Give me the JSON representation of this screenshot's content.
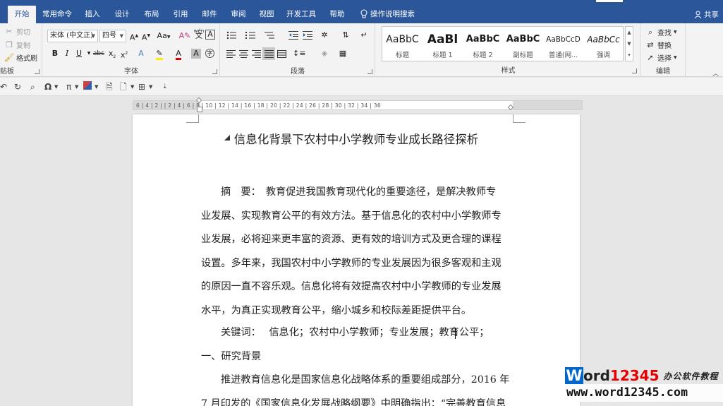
{
  "tabs": [
    {
      "label": "开始",
      "active": true
    },
    {
      "label": "常用命令"
    },
    {
      "label": "插入"
    },
    {
      "label": "设计"
    },
    {
      "label": "布局"
    },
    {
      "label": "引用"
    },
    {
      "label": "邮件"
    },
    {
      "label": "审阅"
    },
    {
      "label": "视图"
    },
    {
      "label": "开发工具"
    },
    {
      "label": "帮助"
    }
  ],
  "tell_me": "操作说明搜索",
  "share": "共享",
  "clipboard": {
    "cut": "剪切",
    "copy": "复制",
    "format_painter": "格式刷",
    "label": "贴板"
  },
  "font": {
    "name": "宋体 (中文正)",
    "size": "四号",
    "label": "字体",
    "aa": "Aa",
    "wen": "wén"
  },
  "paragraph": {
    "label": "段落"
  },
  "styles": {
    "label": "样式",
    "items": [
      {
        "sample": "AaBbC",
        "name": "标题"
      },
      {
        "sample": "AaBl",
        "name": "标题 1"
      },
      {
        "sample": "AaBbC",
        "name": "标题 2"
      },
      {
        "sample": "AaBbC",
        "name": "副标题"
      },
      {
        "sample": "AaBbCcD",
        "name": "普通(网..."
      },
      {
        "sample": "AaBbCc",
        "name": "强调"
      }
    ]
  },
  "editing": {
    "find": "查找",
    "replace": "替换",
    "select": "选择",
    "label": "编辑"
  },
  "ruler": {
    "numbers": "6 | 4 | 2 |   | 2 | 4 | 6 | 8 | 10 | 12 | 14 | 16 | 18 | 20 | 22 | 24 | 26 | 28 | 30 | 32 | 34 | 36"
  },
  "document": {
    "title": "信息化背景下农村中小学教师专业成长路径探析",
    "abstract_lines": [
      "摘　要：　教育促进我国教育现代化的重要途径，是解决教师专",
      "业发展、实现教育公平的有效方法。基于信息化的农村中小学教师专",
      "业发展，必将迎来更丰富的资源、更有效的培训方式及更合理的课程",
      "设置。多年来，我国农村中小学教师的专业发展因为很多客观和主观",
      "的原因一直不容乐观。信息化将有效提高农村中小学教师的专业发展",
      "水平，为真正实现教育公平，缩小城乡和校际差距提供平台。"
    ],
    "keywords": "关键词：　 信息化；农村中小学教师；专业发展；教育公平；",
    "section": "一、研究背景",
    "body_lines": [
      "推进教育信息化是国家信息化战略体系的重要组成部分，2016 年",
      "7 月印发的《国家信息化发展战略纲要》中明确指出：“完善教育信息"
    ]
  },
  "watermark": {
    "w": "W",
    "ord": "ord",
    "num": "12345",
    "tag": "办公软件教程",
    "url": "www.word12345.com"
  },
  "colors": {
    "ribbon_blue": "#2b579a",
    "watermark_blue": "#0066cc",
    "watermark_red": "#e40000"
  }
}
